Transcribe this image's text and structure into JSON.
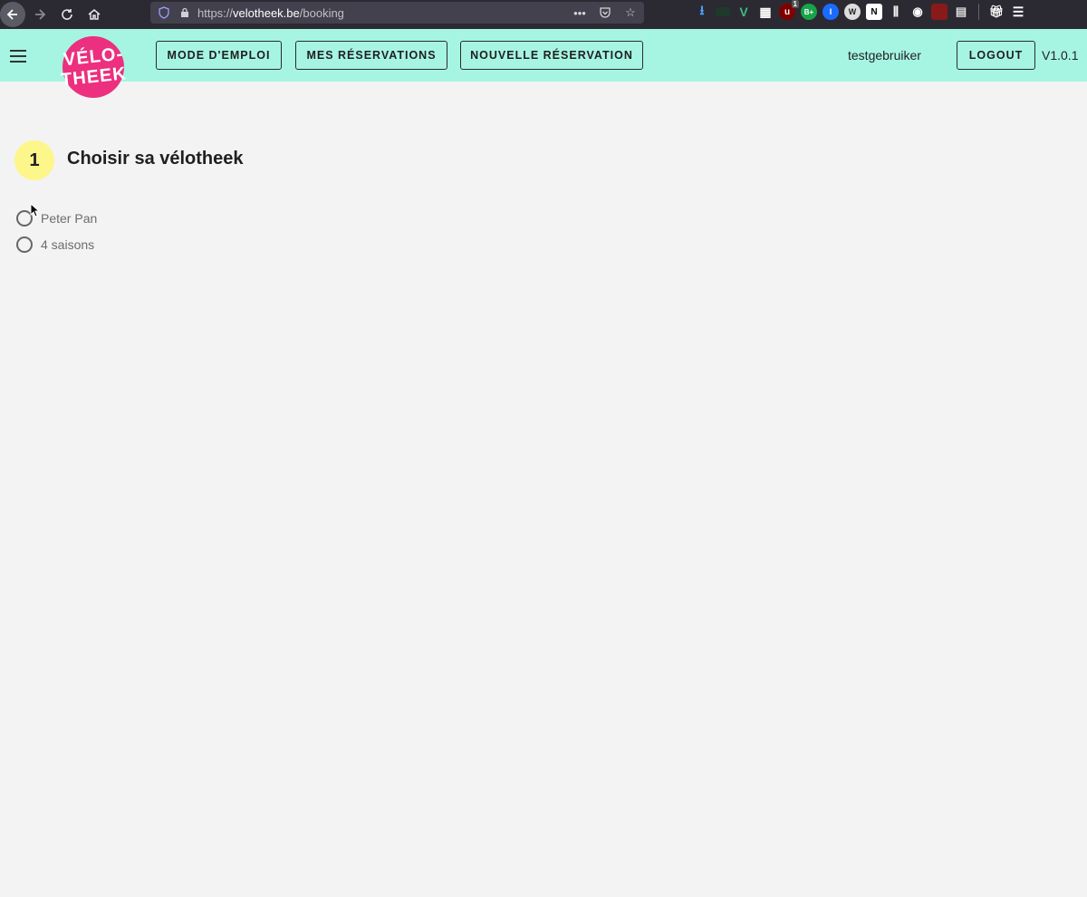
{
  "browser": {
    "url_scheme": "https://",
    "url_host": "velotheek.be",
    "url_path": "/booking",
    "ext_badge_count": "1"
  },
  "header": {
    "logo_line1": "VÉLO-",
    "logo_line2": "THEEK",
    "nav": [
      {
        "label": "MODE D'EMPLOI"
      },
      {
        "label": "MES RÉSERVATIONS"
      },
      {
        "label": "NOUVELLE RÉSERVATION"
      }
    ],
    "username": "testgebruiker",
    "logout_label": "LOGOUT",
    "version": "V1.0.1",
    "bg_color": "#a6f5e2"
  },
  "step": {
    "number": "1",
    "title": "Choisir sa vélotheek",
    "badge_color": "#fdf68a",
    "options": [
      {
        "label": "Peter Pan"
      },
      {
        "label": "4 saisons"
      }
    ]
  }
}
